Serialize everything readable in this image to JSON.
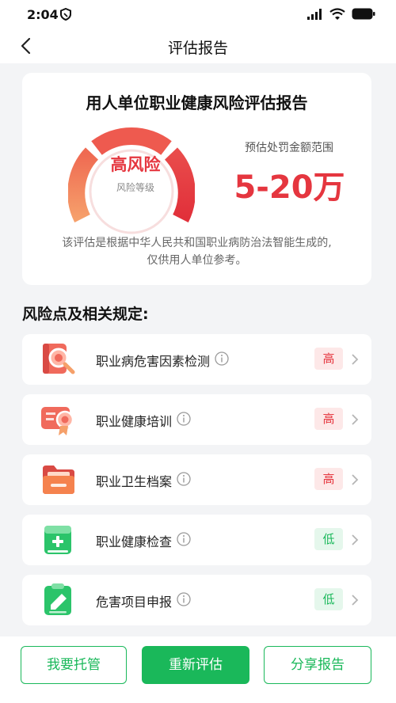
{
  "status_bar": {
    "time": "2:04"
  },
  "nav": {
    "title": "评估报告"
  },
  "report": {
    "title": "用人单位职业健康风险评估报告",
    "risk_level": "高风险",
    "risk_level_caption": "风险等级",
    "fine_label": "预估处罚金额范围",
    "fine_value": "5-20万",
    "note_line1": "该评估是根据中华人民共和国职业病防治法智能生成的,",
    "note_line2": "仅供用人单位参考。"
  },
  "risk_section": {
    "title": "风险点及相关规定:",
    "items": [
      {
        "label": "职业病危害因素检测",
        "level": "高",
        "icon": "magnifier-report-icon"
      },
      {
        "label": "职业健康培训",
        "level": "高",
        "icon": "certificate-icon"
      },
      {
        "label": "职业卫生档案",
        "level": "高",
        "icon": "folder-icon"
      },
      {
        "label": "职业健康检查",
        "level": "低",
        "icon": "medical-book-icon"
      },
      {
        "label": "危害项目申报",
        "level": "低",
        "icon": "clipboard-pen-icon"
      }
    ]
  },
  "actions": {
    "custody": "我要托管",
    "reassess": "重新评估",
    "share": "分享报告"
  },
  "colors": {
    "primary_green": "#1ab85a",
    "risk_red": "#e5363f",
    "badge_high_bg": "#fde8e8",
    "badge_low_bg": "#e5f7ec"
  }
}
